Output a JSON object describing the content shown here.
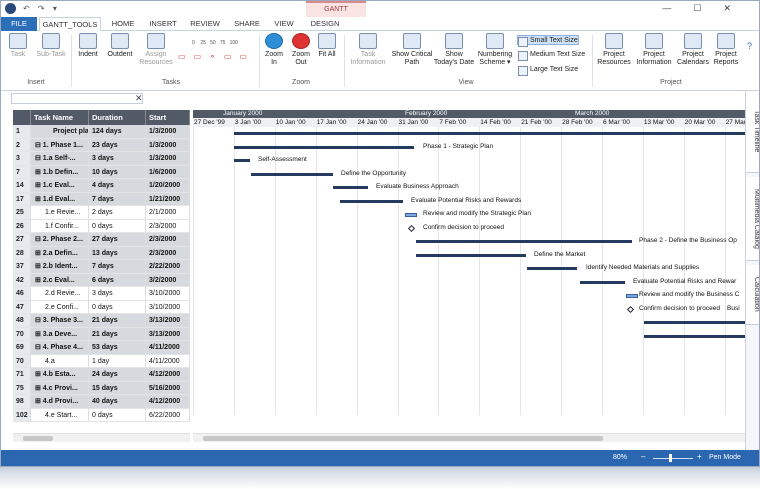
{
  "title_bar": {
    "contextual_tab": "GANTT",
    "quick_access": "↶ ↷ ▾"
  },
  "tabs": [
    "FILE",
    "GANTT_TOOLS",
    "HOME",
    "INSERT",
    "REVIEW",
    "SHARE",
    "VIEW",
    "DESIGN"
  ],
  "ribbon": {
    "task": "Task",
    "subtask": "Sub-Task",
    "insert_group": "Insert",
    "indent": "Indent",
    "outdent": "Outdent",
    "assign_resources": "Assign Resources",
    "percent_labels": [
      "0",
      "25",
      "50",
      "75",
      "100"
    ],
    "tasks_group": "Tasks",
    "zoom_in": "Zoom In",
    "zoom_out": "Zoom Out",
    "fit_all": "Fit All",
    "zoom_group": "Zoom",
    "task_information": "Task Information",
    "show_critical_path": "Show Critical Path",
    "show_todays_date": "Show Today's Date",
    "numbering_scheme": "Numbering Scheme ▾",
    "small_text": "Small Text Size",
    "medium_text": "Medium Text Size",
    "large_text": "Large Text Size",
    "view_group": "View",
    "project_resources": "Project Resources",
    "project_information": "Project Information",
    "project_calendars": "Project Calendars",
    "project_reports": "Project Reports",
    "project_group": "Project"
  },
  "grid": {
    "headers": [
      "Task Name",
      "Duration",
      "Start"
    ],
    "rows": [
      {
        "id": "1",
        "name": "Project plan...",
        "dur": "124 days",
        "start": "1/3/2000",
        "sum": true
      },
      {
        "id": "2",
        "name": "⊟ 1. Phase 1...",
        "dur": "23 days",
        "start": "1/3/2000",
        "sum": true
      },
      {
        "id": "3",
        "name": "⊟ 1.a Self-...",
        "dur": "3 days",
        "start": "1/3/2000",
        "sum": true
      },
      {
        "id": "7",
        "name": "⊞ 1.b Defin...",
        "dur": "10 days",
        "start": "1/6/2000",
        "sum": true
      },
      {
        "id": "14",
        "name": "⊞ 1.c Eval...",
        "dur": "4 days",
        "start": "1/20/2000",
        "sum": true
      },
      {
        "id": "17",
        "name": "⊞ 1.d Eval...",
        "dur": "7 days",
        "start": "1/21/2000",
        "sum": true
      },
      {
        "id": "25",
        "name": "1.e Revie...",
        "dur": "2 days",
        "start": "2/1/2000",
        "sum": false
      },
      {
        "id": "26",
        "name": "1.f Confir...",
        "dur": "0 days",
        "start": "2/3/2000",
        "sum": false
      },
      {
        "id": "27",
        "name": "⊟ 2. Phase 2...",
        "dur": "27 days",
        "start": "2/3/2000",
        "sum": true
      },
      {
        "id": "28",
        "name": "⊞ 2.a Defin...",
        "dur": "13 days",
        "start": "2/3/2000",
        "sum": true
      },
      {
        "id": "37",
        "name": "⊞ 2.b Ident...",
        "dur": "7 days",
        "start": "2/22/2000",
        "sum": true
      },
      {
        "id": "42",
        "name": "⊞ 2.c Eval...",
        "dur": "6 days",
        "start": "3/2/2000",
        "sum": true
      },
      {
        "id": "46",
        "name": "2.d Revie...",
        "dur": "3 days",
        "start": "3/10/2000",
        "sum": false
      },
      {
        "id": "47",
        "name": "2.e Confi...",
        "dur": "0 days",
        "start": "3/10/2000",
        "sum": false
      },
      {
        "id": "48",
        "name": "⊟ 3. Phase 3...",
        "dur": "21 days",
        "start": "3/13/2000",
        "sum": true
      },
      {
        "id": "70",
        "name": "⊞ 3.a Deve...",
        "dur": "21 days",
        "start": "3/13/2000",
        "sum": true
      },
      {
        "id": "69",
        "name": "⊟ 4. Phase 4...",
        "dur": "53 days",
        "start": "4/11/2000",
        "sum": true
      },
      {
        "id": "70",
        "name": "4.a",
        "dur": "1 day",
        "start": "4/11/2000",
        "sum": false
      },
      {
        "id": "71",
        "name": "⊞ 4.b Esta...",
        "dur": "24 days",
        "start": "4/12/2000",
        "sum": true
      },
      {
        "id": "75",
        "name": "⊞ 4.c Provi...",
        "dur": "15 days",
        "start": "5/16/2000",
        "sum": true
      },
      {
        "id": "98",
        "name": "⊞ 4.d Provi...",
        "dur": "40 days",
        "start": "4/12/2000",
        "sum": true
      },
      {
        "id": "102",
        "name": "4.e Start...",
        "dur": "0 days",
        "start": "6/22/2000",
        "sum": false
      }
    ]
  },
  "chart": {
    "months": [
      "January 2000",
      "February 2000",
      "March 2000"
    ],
    "weeks": [
      "27 Dec '99",
      "3 Jan '00",
      "10 Jan '00",
      "17 Jan '00",
      "24 Jan '00",
      "31 Jan '00",
      "7 Feb '00",
      "14 Feb '00",
      "21 Feb '00",
      "28 Feb '00",
      "6 Mar '00",
      "13 Mar '00",
      "20 Mar '00",
      "27 Mar"
    ],
    "labels": {
      "r1": "Phase 1 - Strategic Plan",
      "r2": "Self-Assessment",
      "r3": "Define the Opportunity",
      "r4": "Evaluate Business Approach",
      "r5": "Evaluate Potential Risks and Rewards",
      "r6": "Review and modify the Strategic Plan",
      "r7": "Confirm decision to proceed",
      "r8": "Phase 2 - Define the Business Op",
      "r9": "Define the Market",
      "r10": "Identify Needed Materials and Supplies",
      "r11": "Evaluate Potential Risks and Rewar",
      "r12": "Review and modify the Business C",
      "r13": "Confirm decision to proceed",
      "r13b": "Busi"
    }
  },
  "side_tabs": [
    "Task Timeline",
    "Multimedia Catalog",
    "Calculation"
  ],
  "status": {
    "zoom": "80%",
    "mode": "Pen Mode"
  }
}
